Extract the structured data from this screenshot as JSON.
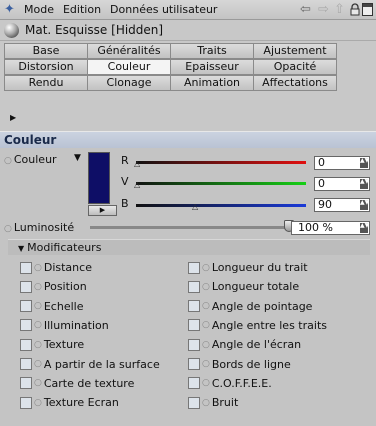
{
  "menubar": {
    "items": [
      "Mode",
      "Edition",
      "Données utilisateur"
    ]
  },
  "title": "Mat. Esquisse [Hidden]",
  "tabs": [
    [
      "Base",
      "Généralités",
      "Traits",
      "Ajustement"
    ],
    [
      "Distorsion",
      "Couleur",
      "Epaisseur",
      "Opacité"
    ],
    [
      "Rendu",
      "Clonage",
      "Animation",
      "Affectations"
    ]
  ],
  "active_tab": "Couleur",
  "section": {
    "title": "Couleur",
    "color_label": "Couleur",
    "color_hex": "#0e0e66",
    "channels": [
      {
        "label": "R",
        "value": "0",
        "position": 0.0
      },
      {
        "label": "V",
        "value": "0",
        "position": 0.0
      },
      {
        "label": "B",
        "value": "90",
        "position": 0.9
      }
    ],
    "luminosite_label": "Luminosité",
    "luminosite_value": "100 %"
  },
  "modificateurs": {
    "title": "Modificateurs",
    "left": [
      "Distance",
      "Position",
      "Echelle",
      "Illumination",
      "Texture",
      "A partir de la surface",
      "Carte de texture",
      "Texture Ecran"
    ],
    "right": [
      "Longueur du trait",
      "Longueur totale",
      "Angle de pointage",
      "Angle entre les traits",
      "Angle de l'écran",
      "Bords de ligne",
      "C.O.F.F.E.E.",
      "Bruit"
    ]
  }
}
